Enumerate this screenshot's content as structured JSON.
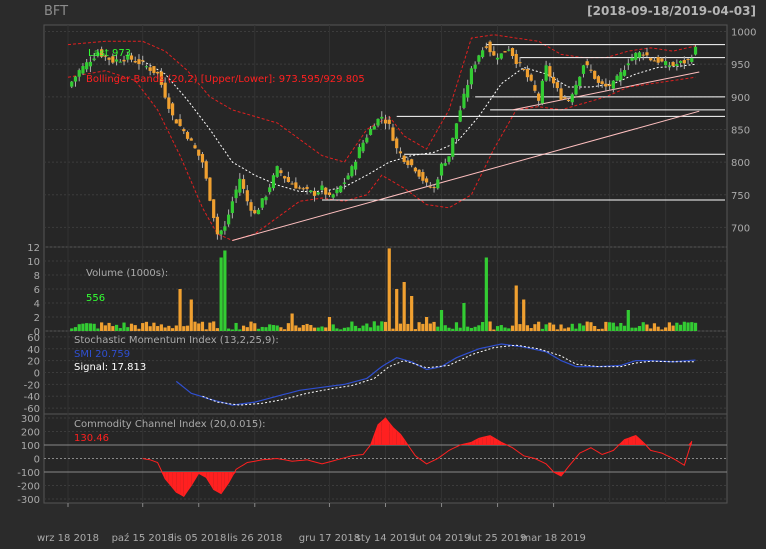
{
  "header": {
    "ticker": "BFT",
    "date_range": "[2018-09-18/2019-04-03]"
  },
  "legend": {
    "last": "Last 973",
    "bbands": "Bollinger Bands (20,2) [Upper/Lower]: 973.595/929.805",
    "volume_title": "Volume (1000s):",
    "volume_last": "556",
    "smi_title": "Stochastic Momentum Index (13,2,25,9):",
    "smi_value": "SMI 20.759",
    "smi_signal": "Signal: 17.813",
    "cci_title": "Commodity Channel Index (20,0.015):",
    "cci_value": "130.46"
  },
  "colors": {
    "background": "#2b2b2b",
    "up": "#33cc33",
    "down": "#f0a030",
    "bband": "#e02020",
    "sma": "#ffffff",
    "trendline": "#ffc0c0",
    "smi": "#2f4fd0",
    "cci": "#ff2020",
    "grid": "#3c3c3c"
  },
  "chart_data": {
    "type": "candlestick",
    "date_range": [
      "2018-09-18",
      "2019-04-03"
    ],
    "x_tick_labels": [
      "wrz 18 2018",
      "paź 15 2018",
      "lis 05 2018",
      "lis 26 2018",
      "gru 17 2018",
      "sty 14 2019",
      "lut 04 2019",
      "lut 25 2019",
      "mar 18 2019"
    ],
    "price": {
      "ylim": [
        670,
        1010
      ],
      "yticks": [
        700,
        750,
        800,
        850,
        900,
        950,
        1000
      ],
      "close_anchors": [
        [
          0,
          915
        ],
        [
          3,
          940
        ],
        [
          8,
          968
        ],
        [
          12,
          955
        ],
        [
          16,
          960
        ],
        [
          20,
          950
        ],
        [
          24,
          935
        ],
        [
          28,
          870
        ],
        [
          32,
          840
        ],
        [
          36,
          800
        ],
        [
          40,
          690
        ],
        [
          42,
          700
        ],
        [
          44,
          740
        ],
        [
          46,
          775
        ],
        [
          48,
          740
        ],
        [
          50,
          720
        ],
        [
          53,
          750
        ],
        [
          56,
          790
        ],
        [
          59,
          770
        ],
        [
          62,
          760
        ],
        [
          64,
          755
        ],
        [
          66,
          752
        ],
        [
          68,
          760
        ],
        [
          70,
          745
        ],
        [
          72,
          755
        ],
        [
          74,
          770
        ],
        [
          76,
          790
        ],
        [
          78,
          820
        ],
        [
          80,
          840
        ],
        [
          82,
          860
        ],
        [
          84,
          870
        ],
        [
          86,
          855
        ],
        [
          88,
          820
        ],
        [
          90,
          805
        ],
        [
          93,
          790
        ],
        [
          96,
          765
        ],
        [
          98,
          760
        ],
        [
          100,
          795
        ],
        [
          102,
          810
        ],
        [
          104,
          860
        ],
        [
          106,
          900
        ],
        [
          108,
          940
        ],
        [
          110,
          965
        ],
        [
          112,
          980
        ],
        [
          114,
          962
        ],
        [
          116,
          965
        ],
        [
          118,
          975
        ],
        [
          120,
          955
        ],
        [
          122,
          940
        ],
        [
          124,
          920
        ],
        [
          126,
          895
        ],
        [
          128,
          945
        ],
        [
          130,
          920
        ],
        [
          132,
          900
        ],
        [
          134,
          895
        ],
        [
          136,
          920
        ],
        [
          138,
          950
        ],
        [
          140,
          940
        ],
        [
          142,
          920
        ],
        [
          144,
          915
        ],
        [
          146,
          920
        ],
        [
          148,
          935
        ],
        [
          150,
          955
        ],
        [
          152,
          965
        ],
        [
          154,
          968
        ],
        [
          156,
          958
        ],
        [
          158,
          955
        ],
        [
          160,
          950
        ],
        [
          162,
          948
        ],
        [
          164,
          952
        ],
        [
          166,
          955
        ],
        [
          168,
          973
        ]
      ],
      "bollinger_upper": [
        [
          0,
          980
        ],
        [
          10,
          985
        ],
        [
          20,
          985
        ],
        [
          26,
          970
        ],
        [
          32,
          940
        ],
        [
          38,
          900
        ],
        [
          44,
          880
        ],
        [
          50,
          870
        ],
        [
          56,
          860
        ],
        [
          62,
          835
        ],
        [
          68,
          810
        ],
        [
          74,
          800
        ],
        [
          80,
          850
        ],
        [
          86,
          870
        ],
        [
          90,
          840
        ],
        [
          96,
          820
        ],
        [
          102,
          880
        ],
        [
          108,
          990
        ],
        [
          114,
          995
        ],
        [
          120,
          990
        ],
        [
          126,
          985
        ],
        [
          132,
          965
        ],
        [
          138,
          960
        ],
        [
          144,
          960
        ],
        [
          150,
          970
        ],
        [
          156,
          975
        ],
        [
          162,
          970
        ],
        [
          168,
          978
        ]
      ],
      "bollinger_lower": [
        [
          0,
          930
        ],
        [
          10,
          940
        ],
        [
          18,
          925
        ],
        [
          24,
          880
        ],
        [
          30,
          810
        ],
        [
          36,
          730
        ],
        [
          40,
          690
        ],
        [
          44,
          680
        ],
        [
          50,
          690
        ],
        [
          56,
          715
        ],
        [
          62,
          740
        ],
        [
          68,
          745
        ],
        [
          74,
          740
        ],
        [
          80,
          750
        ],
        [
          84,
          780
        ],
        [
          90,
          760
        ],
        [
          96,
          735
        ],
        [
          102,
          730
        ],
        [
          108,
          750
        ],
        [
          114,
          820
        ],
        [
          120,
          880
        ],
        [
          126,
          885
        ],
        [
          132,
          880
        ],
        [
          138,
          890
        ],
        [
          144,
          900
        ],
        [
          150,
          915
        ],
        [
          156,
          920
        ],
        [
          162,
          925
        ],
        [
          168,
          930
        ]
      ],
      "sma": [
        [
          20,
          955
        ],
        [
          26,
          935
        ],
        [
          32,
          895
        ],
        [
          38,
          850
        ],
        [
          44,
          800
        ],
        [
          50,
          780
        ],
        [
          56,
          765
        ],
        [
          62,
          755
        ],
        [
          68,
          755
        ],
        [
          74,
          762
        ],
        [
          80,
          780
        ],
        [
          86,
          800
        ],
        [
          92,
          810
        ],
        [
          98,
          815
        ],
        [
          104,
          830
        ],
        [
          110,
          870
        ],
        [
          116,
          920
        ],
        [
          122,
          945
        ],
        [
          128,
          935
        ],
        [
          134,
          915
        ],
        [
          140,
          915
        ],
        [
          146,
          920
        ],
        [
          152,
          935
        ],
        [
          158,
          945
        ],
        [
          164,
          947
        ],
        [
          168,
          950
        ]
      ],
      "horizontal_lines": [
        {
          "y": 980,
          "from": 112
        },
        {
          "y": 960,
          "from": 121
        },
        {
          "y": 900,
          "from": 109
        },
        {
          "y": 880,
          "from": 113
        },
        {
          "y": 870,
          "from": 88
        },
        {
          "y": 812,
          "from": 90
        },
        {
          "y": 742,
          "from": 68
        }
      ],
      "trendlines": [
        {
          "from": [
            44,
            680
          ],
          "to": [
            169,
            878
          ]
        },
        {
          "from": [
            119,
            880
          ],
          "to": [
            169,
            938
          ]
        }
      ]
    },
    "volume": {
      "ylim": [
        0,
        12
      ],
      "yticks": [
        0,
        2,
        4,
        6,
        8,
        10,
        12
      ],
      "unit": "1000s",
      "spikes": [
        [
          42,
          11.5
        ],
        [
          41,
          10.5
        ],
        [
          86,
          11.8
        ],
        [
          112,
          10.5
        ],
        [
          90,
          7
        ],
        [
          92,
          5
        ],
        [
          30,
          6
        ],
        [
          33,
          4.5
        ],
        [
          88,
          6
        ],
        [
          120,
          6.5
        ],
        [
          122,
          4.5
        ],
        [
          100,
          3
        ],
        [
          106,
          4
        ],
        [
          150,
          3
        ],
        [
          96,
          2
        ],
        [
          60,
          2.5
        ],
        [
          70,
          2
        ]
      ]
    },
    "smi": {
      "ylim": [
        -70,
        70
      ],
      "yticks": [
        -60,
        -40,
        -20,
        0,
        20,
        40,
        60
      ],
      "smi_anchors": [
        [
          29,
          -15
        ],
        [
          33,
          -35
        ],
        [
          38,
          -45
        ],
        [
          44,
          -55
        ],
        [
          50,
          -50
        ],
        [
          56,
          -40
        ],
        [
          62,
          -30
        ],
        [
          68,
          -25
        ],
        [
          74,
          -20
        ],
        [
          80,
          -10
        ],
        [
          84,
          10
        ],
        [
          88,
          25
        ],
        [
          92,
          18
        ],
        [
          96,
          5
        ],
        [
          100,
          10
        ],
        [
          104,
          25
        ],
        [
          110,
          40
        ],
        [
          116,
          48
        ],
        [
          122,
          43
        ],
        [
          128,
          35
        ],
        [
          132,
          20
        ],
        [
          136,
          10
        ],
        [
          142,
          10
        ],
        [
          148,
          12
        ],
        [
          152,
          20
        ],
        [
          156,
          20
        ],
        [
          162,
          18
        ],
        [
          168,
          21
        ]
      ],
      "signal_anchors": [
        [
          36,
          -40
        ],
        [
          40,
          -50
        ],
        [
          46,
          -55
        ],
        [
          52,
          -52
        ],
        [
          58,
          -45
        ],
        [
          64,
          -35
        ],
        [
          70,
          -28
        ],
        [
          76,
          -22
        ],
        [
          82,
          -10
        ],
        [
          86,
          10
        ],
        [
          90,
          20
        ],
        [
          96,
          8
        ],
        [
          102,
          12
        ],
        [
          108,
          30
        ],
        [
          114,
          42
        ],
        [
          120,
          46
        ],
        [
          126,
          40
        ],
        [
          132,
          28
        ],
        [
          136,
          14
        ],
        [
          142,
          10
        ],
        [
          148,
          10
        ],
        [
          152,
          16
        ],
        [
          156,
          19
        ],
        [
          162,
          18
        ],
        [
          168,
          18
        ]
      ]
    },
    "cci": {
      "ylim": [
        -330,
        330
      ],
      "yticks": [
        -300,
        -200,
        -100,
        0,
        100,
        200,
        300
      ],
      "anchors": [
        [
          20,
          0
        ],
        [
          22,
          -10
        ],
        [
          24,
          -30
        ],
        [
          26,
          -150
        ],
        [
          29,
          -250
        ],
        [
          31,
          -280
        ],
        [
          33,
          -200
        ],
        [
          35,
          -110
        ],
        [
          37,
          -140
        ],
        [
          39,
          -230
        ],
        [
          41,
          -260
        ],
        [
          43,
          -180
        ],
        [
          45,
          -80
        ],
        [
          48,
          -30
        ],
        [
          52,
          -10
        ],
        [
          56,
          0
        ],
        [
          60,
          -20
        ],
        [
          64,
          -10
        ],
        [
          68,
          -40
        ],
        [
          72,
          -10
        ],
        [
          76,
          20
        ],
        [
          79,
          30
        ],
        [
          81,
          100
        ],
        [
          83,
          250
        ],
        [
          85,
          300
        ],
        [
          87,
          230
        ],
        [
          89,
          180
        ],
        [
          91,
          100
        ],
        [
          93,
          20
        ],
        [
          96,
          -40
        ],
        [
          99,
          0
        ],
        [
          102,
          60
        ],
        [
          105,
          100
        ],
        [
          108,
          120
        ],
        [
          110,
          150
        ],
        [
          113,
          170
        ],
        [
          116,
          120
        ],
        [
          119,
          80
        ],
        [
          122,
          20
        ],
        [
          125,
          0
        ],
        [
          128,
          -40
        ],
        [
          130,
          -100
        ],
        [
          132,
          -130
        ],
        [
          134,
          -60
        ],
        [
          137,
          40
        ],
        [
          140,
          80
        ],
        [
          143,
          30
        ],
        [
          146,
          60
        ],
        [
          149,
          140
        ],
        [
          152,
          170
        ],
        [
          154,
          120
        ],
        [
          156,
          60
        ],
        [
          159,
          40
        ],
        [
          162,
          0
        ],
        [
          165,
          -50
        ],
        [
          167,
          130
        ]
      ]
    }
  }
}
